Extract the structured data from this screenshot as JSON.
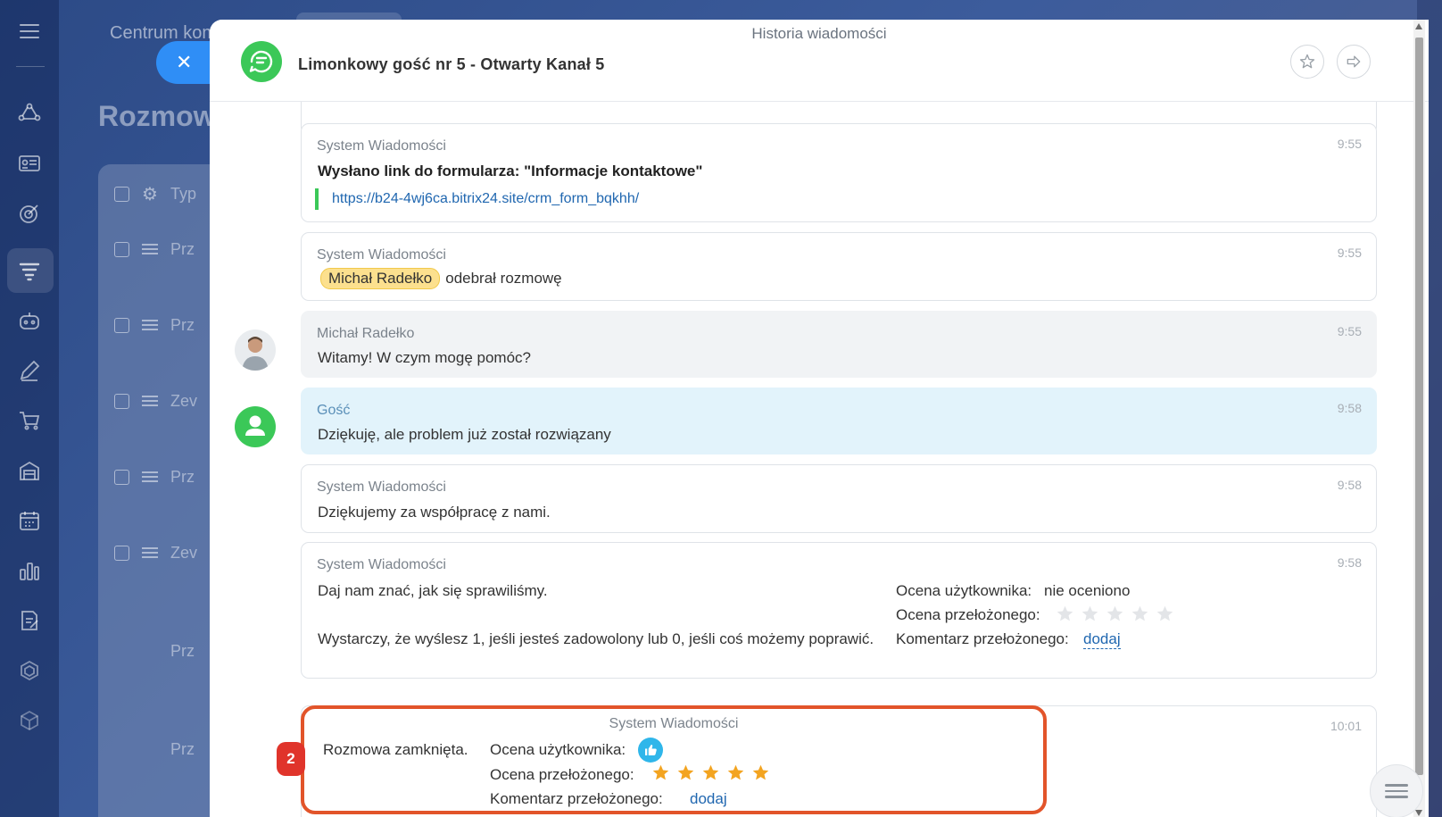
{
  "background": {
    "header_text": "Centrum kom",
    "page_title": "Rozmow",
    "table_header": "Typ",
    "rows": [
      "Prz",
      "Prz",
      "Zev",
      "Prz",
      "Zev",
      "Prz",
      "Prz"
    ]
  },
  "rail_icons": [
    "menu-icon",
    "flow-icon",
    "contact-card-icon",
    "target-icon",
    "funnel-icon",
    "robot-icon",
    "pen-icon",
    "cart-icon",
    "warehouse-icon",
    "calendar-icon",
    "chart-icon",
    "document-icon",
    "shield-icon",
    "box-icon"
  ],
  "panel": {
    "top_title": "Historia wiadomości",
    "chat_title": "Limonkowy gość nr 5 - Otwarty Kanał 5",
    "favorite_icon": "star-icon",
    "forward_icon": "forward-arrow-icon"
  },
  "messages": {
    "partial_text": "",
    "form_link": {
      "author": "System Wiadomości",
      "time": "9:55",
      "text": "Wysłano link do formularza: \"Informacje kontaktowe\"",
      "url": "https://b24-4wj6ca.bitrix24.site/crm_form_bqkhh/"
    },
    "accepted": {
      "author": "System Wiadomości",
      "time": "9:55",
      "mention": "Michał Radełko",
      "text": "odebrał rozmowę"
    },
    "operator": {
      "author": "Michał Radełko",
      "time": "9:55",
      "text": "Witamy! W czym mogę pomóc?"
    },
    "guest": {
      "author": "Gość",
      "time": "9:58",
      "text": "Dziękuję, ale problem już został rozwiązany"
    },
    "thanks": {
      "author": "System Wiadomości",
      "time": "9:58",
      "text": "Dziękujemy za współpracę z nami."
    },
    "feedback": {
      "author": "System Wiadomości",
      "time": "9:58",
      "line1": "Daj nam znać, jak się sprawiliśmy.",
      "line2": "Wystarczy, że wyślesz 1, jeśli jesteś zadowolony lub 0, jeśli coś możemy poprawić.",
      "user_rating_label": "Ocena użytkownika:",
      "user_rating_value": "nie oceniono",
      "supervisor_rating_label": "Ocena przełożonego:",
      "supervisor_stars": 0,
      "supervisor_comment_label": "Komentarz przełożonego:",
      "add_label": "dodaj"
    },
    "closed": {
      "author": "System Wiadomości",
      "time": "10:01",
      "text": "Rozmowa zamknięta.",
      "user_rating_label": "Ocena użytkownika:",
      "supervisor_rating_label": "Ocena przełożonego:",
      "supervisor_stars": 5,
      "supervisor_comment_label": "Komentarz przełożonego:",
      "add_label": "dodaj"
    }
  },
  "annotation_badge": "2",
  "colors": {
    "accent_green": "#3bc858",
    "link_blue": "#2067b0",
    "highlight_red": "#e2542a",
    "star_orange": "#f3a420",
    "star_gray": "#e3e5e8"
  }
}
